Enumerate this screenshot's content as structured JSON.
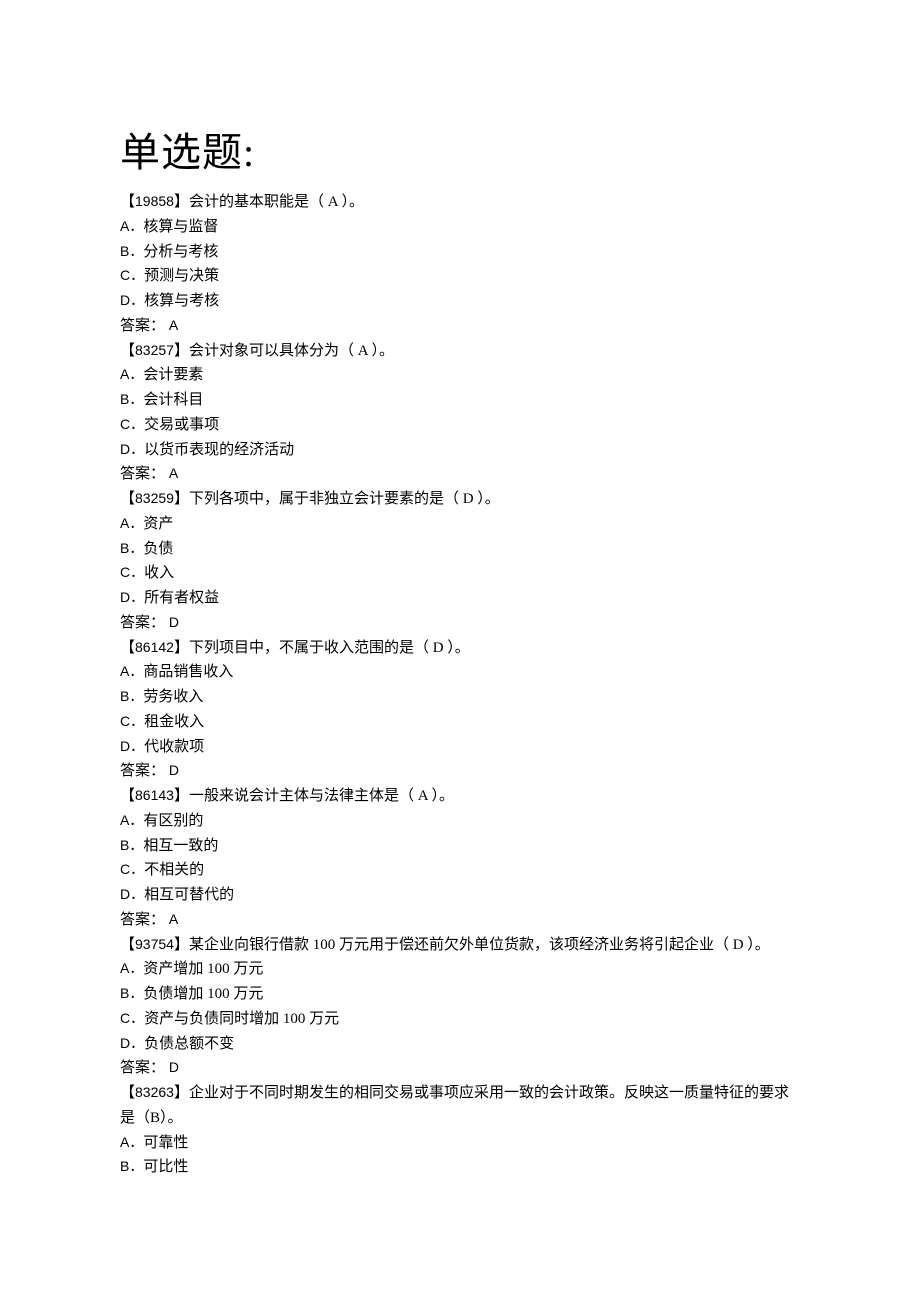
{
  "title": "单选题:",
  "questions": [
    {
      "id": "19858",
      "stem_pre": "【",
      "stem_post": "】会计的基本职能是（   A   ）。",
      "options": [
        {
          "letter": "A．",
          "text": "核算与监督"
        },
        {
          "letter": "B．",
          "text": "分析与考核"
        },
        {
          "letter": "C．",
          "text": "预测与决策"
        },
        {
          "letter": "D．",
          "text": "核算与考核"
        }
      ],
      "answer_label": "答案：",
      "answer": " A"
    },
    {
      "id": "83257",
      "stem_pre": "【",
      "stem_post": "】会计对象可以具体分为（   A   ）。",
      "options": [
        {
          "letter": "A．",
          "text": "会计要素"
        },
        {
          "letter": "B．",
          "text": "会计科目"
        },
        {
          "letter": "C．",
          "text": "交易或事项"
        },
        {
          "letter": "D．",
          "text": "以货币表现的经济活动"
        }
      ],
      "answer_label": "答案：",
      "answer": " A"
    },
    {
      "id": "83259",
      "stem_pre": "【",
      "stem_post": "】下列各项中，属于非独立会计要素的是（   D   ）。",
      "options": [
        {
          "letter": "A．",
          "text": "资产"
        },
        {
          "letter": "B．",
          "text": "负债"
        },
        {
          "letter": "C．",
          "text": "收入"
        },
        {
          "letter": "D．",
          "text": "所有者权益"
        }
      ],
      "answer_label": "答案：",
      "answer": " D"
    },
    {
      "id": "86142",
      "stem_pre": "【",
      "stem_post": "】下列项目中，不属于收入范围的是（   D   ）。",
      "options": [
        {
          "letter": "A．",
          "text": "商品销售收入"
        },
        {
          "letter": "B．",
          "text": "劳务收入"
        },
        {
          "letter": "C．",
          "text": "租金收入"
        },
        {
          "letter": "D．",
          "text": "代收款项"
        }
      ],
      "answer_label": "答案：",
      "answer": " D"
    },
    {
      "id": "86143",
      "stem_pre": "【",
      "stem_post": "】一般来说会计主体与法律主体是（   A   ）。",
      "options": [
        {
          "letter": "A．",
          "text": "有区别的"
        },
        {
          "letter": "B．",
          "text": "相互一致的"
        },
        {
          "letter": "C．",
          "text": "不相关的"
        },
        {
          "letter": "D．",
          "text": "相互可替代的"
        }
      ],
      "answer_label": "答案：",
      "answer": " A"
    },
    {
      "id": "93754",
      "stem_pre": "【",
      "stem_post": "】某企业向银行借款 100 万元用于偿还前欠外单位货款，该项经济业务将引起企业（   D   ）。",
      "options": [
        {
          "letter": "A．",
          "text": "资产增加 100 万元"
        },
        {
          "letter": "B．",
          "text": "负债增加 100 万元"
        },
        {
          "letter": "C．",
          "text": "资产与负债同时增加 100 万元"
        },
        {
          "letter": "D．",
          "text": "负债总额不变"
        }
      ],
      "answer_label": "答案：",
      "answer": " D"
    },
    {
      "id": "83263",
      "stem_pre": "【",
      "stem_post": "】企业对于不同时期发生的相同交易或事项应采用一致的会计政策。反映这一质量特征的要求是（B）。",
      "options": [
        {
          "letter": "A．",
          "text": "可靠性"
        },
        {
          "letter": "B．",
          "text": "可比性"
        }
      ],
      "answer_label": "",
      "answer": ""
    }
  ]
}
